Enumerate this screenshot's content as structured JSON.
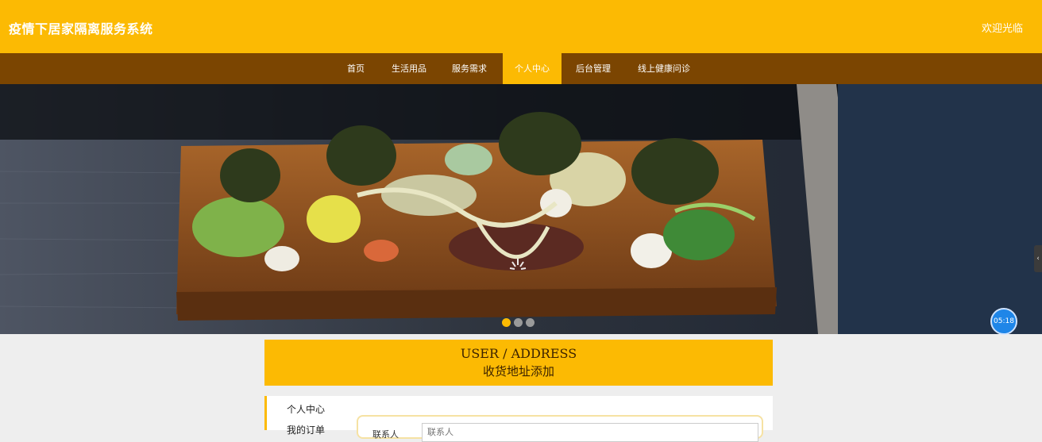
{
  "header": {
    "site_title": "疫情下居家隔离服务系统",
    "welcome": "欢迎光临"
  },
  "nav": {
    "items": [
      {
        "label": "首页"
      },
      {
        "label": "生活用品"
      },
      {
        "label": "服务需求"
      },
      {
        "label": "个人中心",
        "active": true
      },
      {
        "label": "后台管理"
      },
      {
        "label": "线上健康问诊"
      }
    ]
  },
  "carousel": {
    "slide_count": 3,
    "active_index": 0
  },
  "timer": {
    "label": "05:18"
  },
  "section_title": {
    "en": "USER / ADDRESS",
    "zh": "收货地址添加"
  },
  "side_menu": {
    "items": [
      "个人中心",
      "我的订单"
    ]
  },
  "form": {
    "contact_label": "联系人",
    "contact_placeholder": "联系人"
  },
  "colors": {
    "accent": "#fcba03",
    "nav_bg": "#7b4501"
  }
}
